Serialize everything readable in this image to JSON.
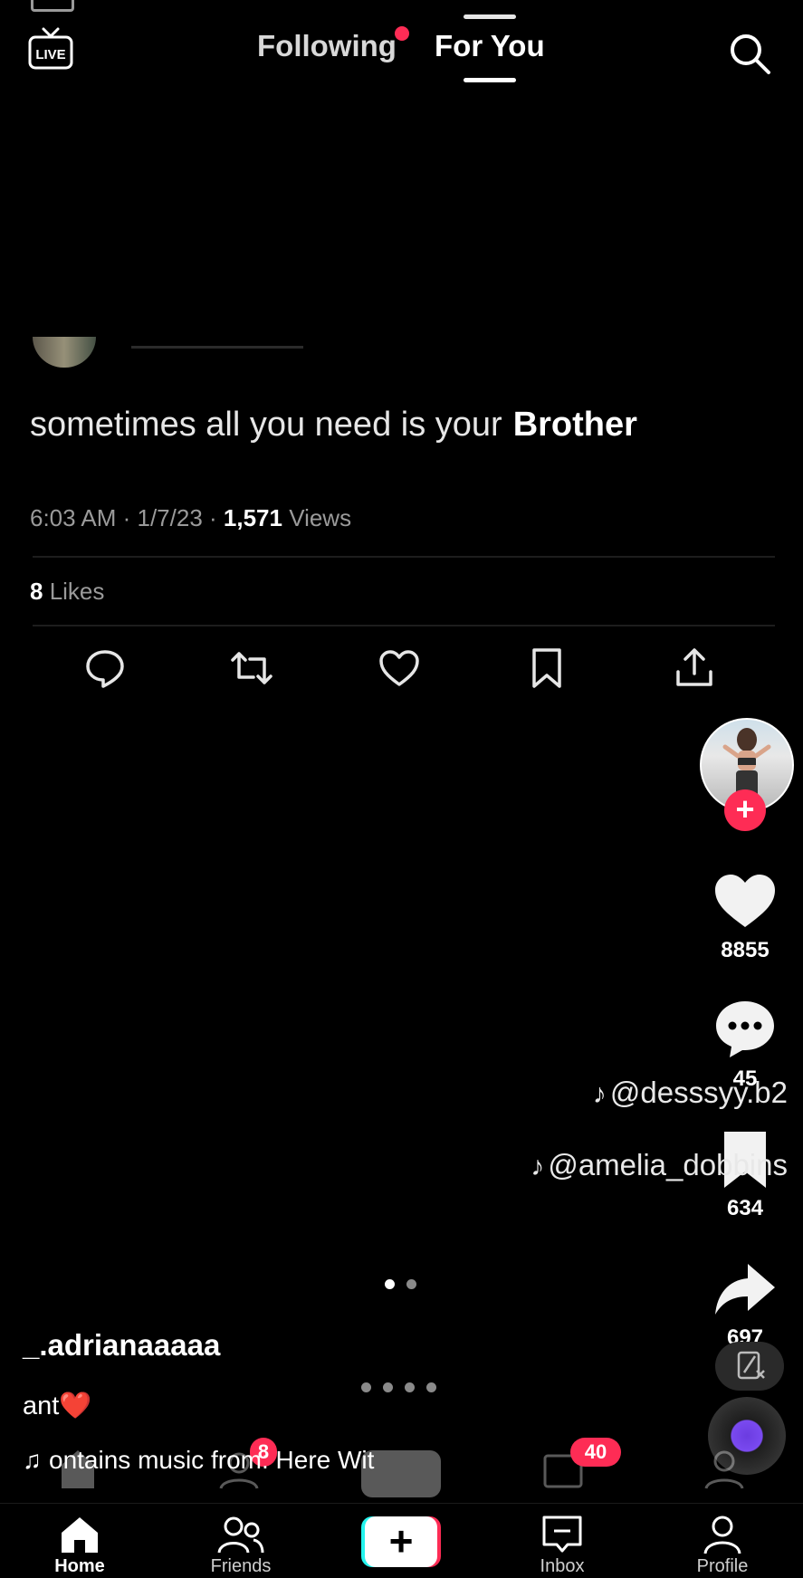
{
  "top_bar": {
    "tabs": [
      {
        "label": "Following",
        "has_dot": true
      },
      {
        "label": "For You",
        "active": true
      }
    ],
    "icons": [
      "live-icon",
      "search-icon"
    ]
  },
  "tweet": {
    "text": "sometimes all you need is your",
    "text_bold": "Brother",
    "time": "6:03 AM · 1/7/23 · ",
    "views_count": "1,571",
    "views_label": " Views",
    "likes_count": "8",
    "likes_label": " Likes",
    "actions": [
      "reply-icon",
      "retweet-icon",
      "like-icon",
      "bookmark-icon",
      "share-icon"
    ]
  },
  "rail": {
    "likes": "8855",
    "comments": "45",
    "saves": "634",
    "shares": "697"
  },
  "watermarks": [
    "@desssyy.b2",
    "@amelia_dobbins"
  ],
  "video": {
    "author": "_.adrianaaaaa",
    "caption": "ant❤️",
    "music": "ontains music from: Here Wit"
  },
  "ghost_badges": {
    "friends": "8",
    "inbox": "40"
  },
  "bottom_nav": {
    "home": "Home",
    "friends": "Friends",
    "create": "+",
    "inbox": "Inbox",
    "profile": "Profile"
  },
  "colors": {
    "accent_red": "#fe2c55",
    "accent_cyan": "#25f4ee",
    "background": "#000000"
  }
}
